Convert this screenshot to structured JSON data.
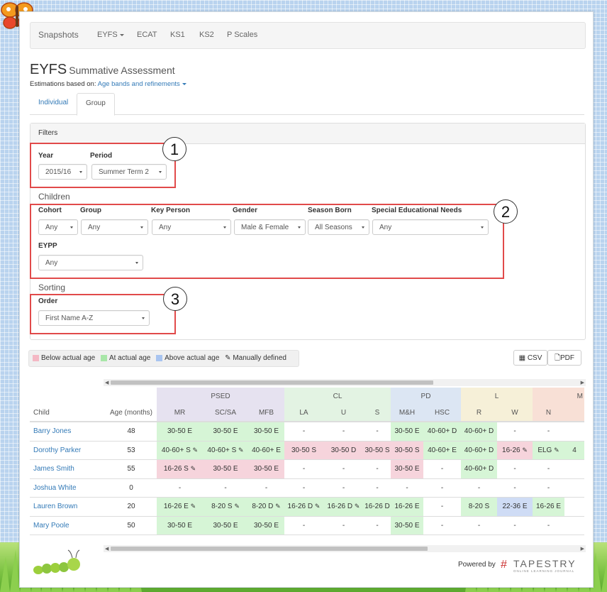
{
  "nav": {
    "items": [
      "Snapshots",
      "EYFS",
      "ECAT",
      "KS1",
      "KS2",
      "P Scales"
    ]
  },
  "page": {
    "title": "EYFS",
    "subtitle": "Summative Assessment",
    "estimations_prefix": "Estimations based on:",
    "estimations_link": "Age bands and refinements"
  },
  "tabs": [
    "Individual",
    "Group"
  ],
  "filters": {
    "heading": "Filters",
    "year_label": "Year",
    "year_value": "2015/16",
    "period_label": "Period",
    "period_value": "Summer Term 2",
    "children_heading": "Children",
    "cohort_label": "Cohort",
    "cohort_value": "Any",
    "group_label": "Group",
    "group_value": "Any",
    "keyperson_label": "Key Person",
    "keyperson_value": "Any",
    "gender_label": "Gender",
    "gender_value": "Male & Female",
    "season_label": "Season Born",
    "season_value": "All Seasons",
    "sen_label": "Special Educational Needs",
    "sen_value": "Any",
    "eypp_label": "EYPP",
    "eypp_value": "Any",
    "sorting_heading": "Sorting",
    "order_label": "Order",
    "order_value": "First Name A-Z"
  },
  "callouts": [
    "1",
    "2",
    "3"
  ],
  "legend": {
    "below": "Below actual age",
    "at": "At actual age",
    "above": "Above actual age",
    "manual": "Manually defined",
    "colors": {
      "below": "#f4b8c4",
      "at": "#a8e6a8",
      "above": "#a8c4f0"
    }
  },
  "export": {
    "csv": "CSV",
    "pdf": "PDF"
  },
  "table": {
    "groups": [
      "PSED",
      "CL",
      "PD",
      "L",
      "M"
    ],
    "columns": [
      "Child",
      "Age (months)",
      "MR",
      "SC/SA",
      "MFB",
      "LA",
      "U",
      "S",
      "M&H",
      "HSC",
      "R",
      "W",
      "N"
    ],
    "rows": [
      {
        "name": "Barry Jones",
        "age": "48",
        "cells": [
          "30-50 E",
          "30-50 E",
          "30-50 E",
          "-",
          "-",
          "-",
          "30-50 E",
          "40-60+ D",
          "40-60+ D",
          "-",
          "-"
        ]
      },
      {
        "name": "Dorothy Parker",
        "age": "53",
        "cells": [
          "40-60+ S",
          "40-60+ S",
          "40-60+ E",
          "30-50 S",
          "30-50 D",
          "30-50 S",
          "30-50 S",
          "40-60+ E",
          "40-60+ D",
          "16-26",
          "ELG"
        ]
      },
      {
        "name": "James Smith",
        "age": "55",
        "cells": [
          "16-26 S",
          "30-50 E",
          "30-50 E",
          "-",
          "-",
          "-",
          "30-50 E",
          "-",
          "40-60+ D",
          "-",
          "-"
        ]
      },
      {
        "name": "Joshua White",
        "age": "0",
        "cells": [
          "-",
          "-",
          "-",
          "-",
          "-",
          "-",
          "-",
          "-",
          "-",
          "-",
          "-"
        ]
      },
      {
        "name": "Lauren Brown",
        "age": "20",
        "cells": [
          "16-26 E",
          "8-20 S",
          "8-20 D",
          "16-26 D",
          "16-26 D",
          "16-26 D",
          "16-26 E",
          "-",
          "8-20 S",
          "22-36 E",
          "16-26 E"
        ]
      },
      {
        "name": "Mary Poole",
        "age": "50",
        "cells": [
          "30-50 E",
          "30-50 E",
          "30-50 E",
          "-",
          "-",
          "-",
          "30-50 E",
          "-",
          "-",
          "-",
          "-"
        ]
      }
    ],
    "extra_cell": "4"
  },
  "footer": {
    "powered": "Powered by",
    "brand": "TAPESTRY",
    "brand_sub": "ONLINE LEARNING JOURNAL"
  }
}
